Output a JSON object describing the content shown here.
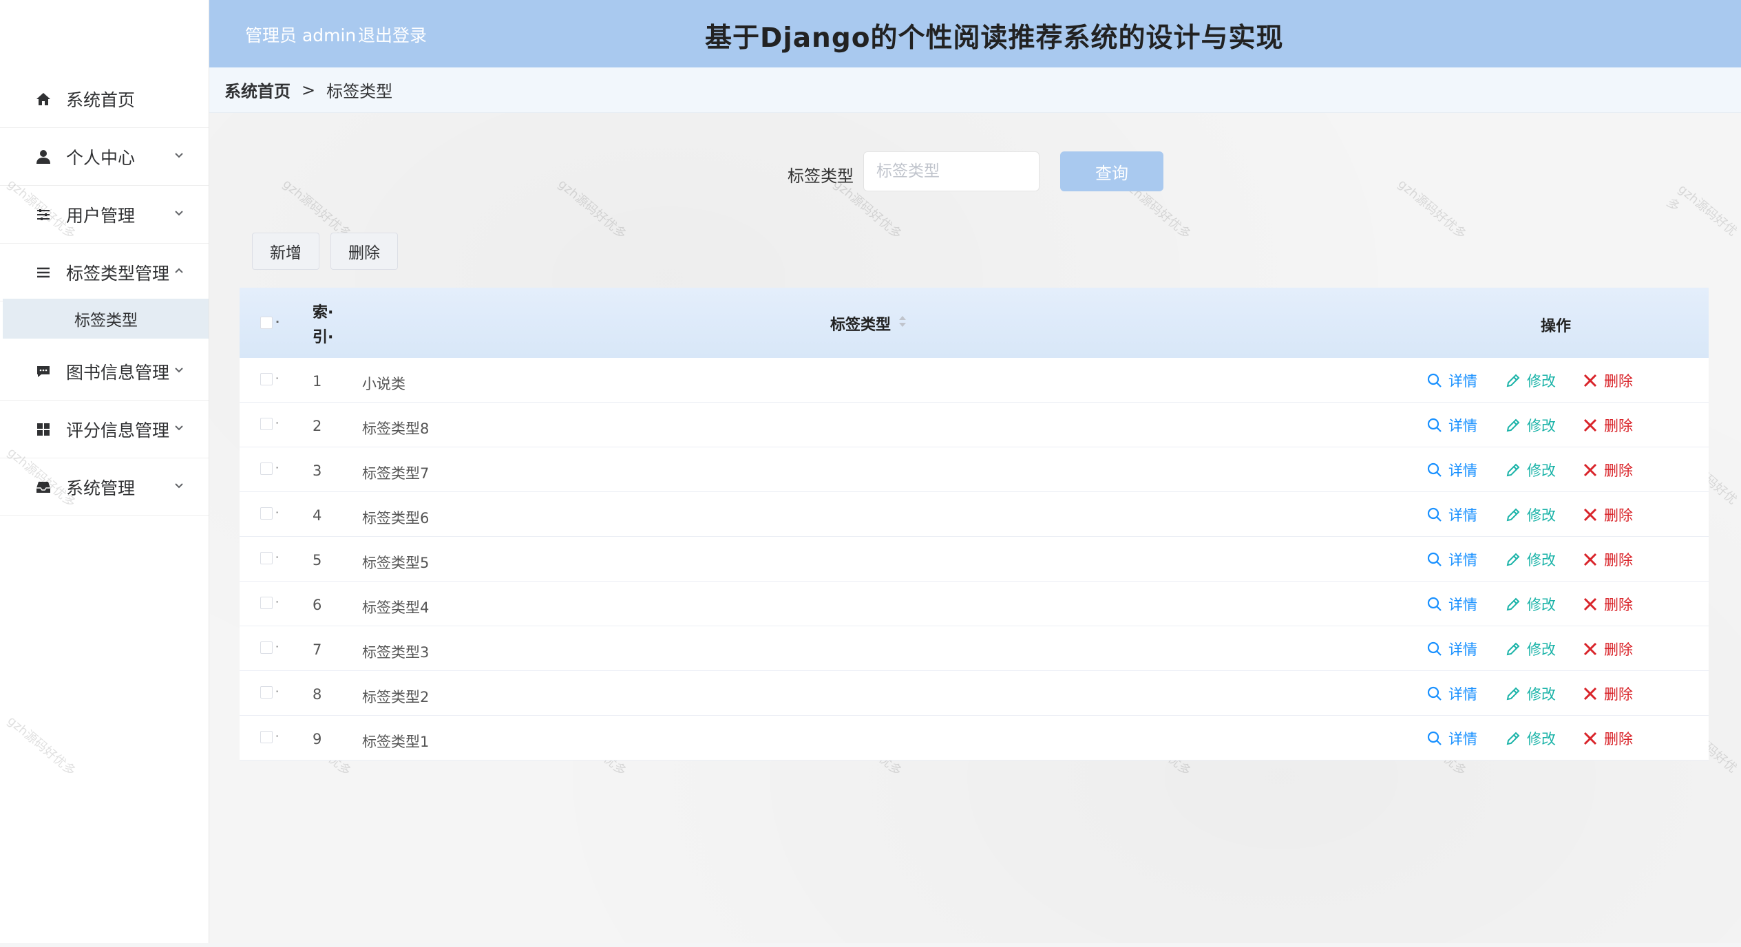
{
  "sidebar": {
    "items": [
      {
        "label": "系统首页",
        "icon": "home-icon"
      },
      {
        "label": "个人中心",
        "icon": "user-icon"
      },
      {
        "label": "用户管理",
        "icon": "sliders-icon"
      },
      {
        "label": "标签类型管理",
        "icon": "list-icon"
      },
      {
        "label": "图书信息管理",
        "icon": "chat-icon"
      },
      {
        "label": "评分信息管理",
        "icon": "grid-icon"
      },
      {
        "label": "系统管理",
        "icon": "inbox-icon"
      }
    ],
    "active_sub": "标签类型"
  },
  "header": {
    "admin_text": "管理员 admin",
    "logout": "退出登录",
    "title": "基于Django的个性阅读推荐系统的设计与实现"
  },
  "breadcrumb": {
    "home": "系统首页",
    "sep": ">",
    "current": "标签类型"
  },
  "search": {
    "label": "标签类型",
    "placeholder": "标签类型",
    "button": "查询"
  },
  "toolbar": {
    "add": "新增",
    "delete": "删除"
  },
  "table": {
    "col_index_top": "索·",
    "col_index_bottom": "引·",
    "col_type": "标签类型",
    "col_ops": "操作",
    "detail": "详情",
    "edit": "修改",
    "del": "删除",
    "rows": [
      {
        "index": "1",
        "type": "小说类"
      },
      {
        "index": "2",
        "type": "标签类型8"
      },
      {
        "index": "3",
        "type": "标签类型7"
      },
      {
        "index": "4",
        "type": "标签类型6"
      },
      {
        "index": "5",
        "type": "标签类型5"
      },
      {
        "index": "6",
        "type": "标签类型4"
      },
      {
        "index": "7",
        "type": "标签类型3"
      },
      {
        "index": "8",
        "type": "标签类型2"
      },
      {
        "index": "9",
        "type": "标签类型1"
      }
    ]
  },
  "watermark": "gzh源码好优多",
  "colors": {
    "header_bg": "#a9c9ef",
    "detail": "#1890ff",
    "edit": "#1ab3a8",
    "delete": "#d9242a"
  }
}
